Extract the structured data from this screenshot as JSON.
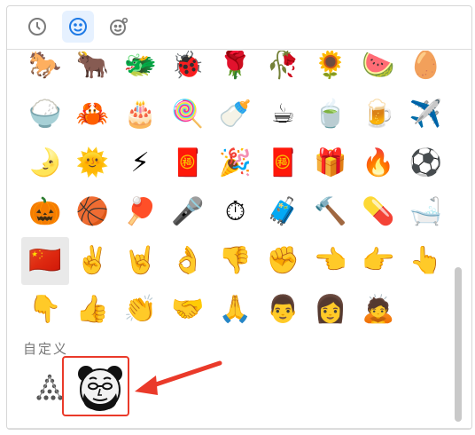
{
  "tabs": [
    {
      "name": "recent",
      "icon": "clock-icon"
    },
    {
      "name": "emoji",
      "icon": "smiley-icon"
    },
    {
      "name": "custom",
      "icon": "smiley-gear-icon"
    }
  ],
  "emoji_rows": [
    [
      "🐎",
      "🐂",
      "🐲",
      "🐞",
      "🌹",
      "🥀",
      "🌻",
      "🍉",
      "🥚"
    ],
    [
      "🍚",
      "🦀",
      "🎂",
      "🍭",
      "🍼",
      "☕",
      "🍵",
      "🍺",
      "✈️"
    ],
    [
      "🌛",
      "🌞",
      "⚡",
      "🧧",
      "🎉",
      "🧧",
      "🎁",
      "🔥",
      "⚽"
    ],
    [
      "🎃",
      "🏀",
      "🏓",
      "🎤",
      "⏱",
      "🧳",
      "🔨",
      "💊",
      "🛁"
    ],
    [
      "🇨🇳",
      "✌️",
      "🤘",
      "👌",
      "👎",
      "✊",
      "👈",
      "👉",
      "👆"
    ],
    [
      "👇",
      "👍",
      "👏",
      "🤝",
      "🙏",
      "👨",
      "👩",
      "🙇"
    ]
  ],
  "section": {
    "title": "自定义"
  },
  "custom_items": [
    {
      "name": "custom-dot-figure",
      "icon": "dot-figure-icon"
    },
    {
      "name": "custom-meme-face",
      "icon": "meme-face-icon"
    }
  ],
  "annotation": {
    "color": "#ea3a2a"
  }
}
